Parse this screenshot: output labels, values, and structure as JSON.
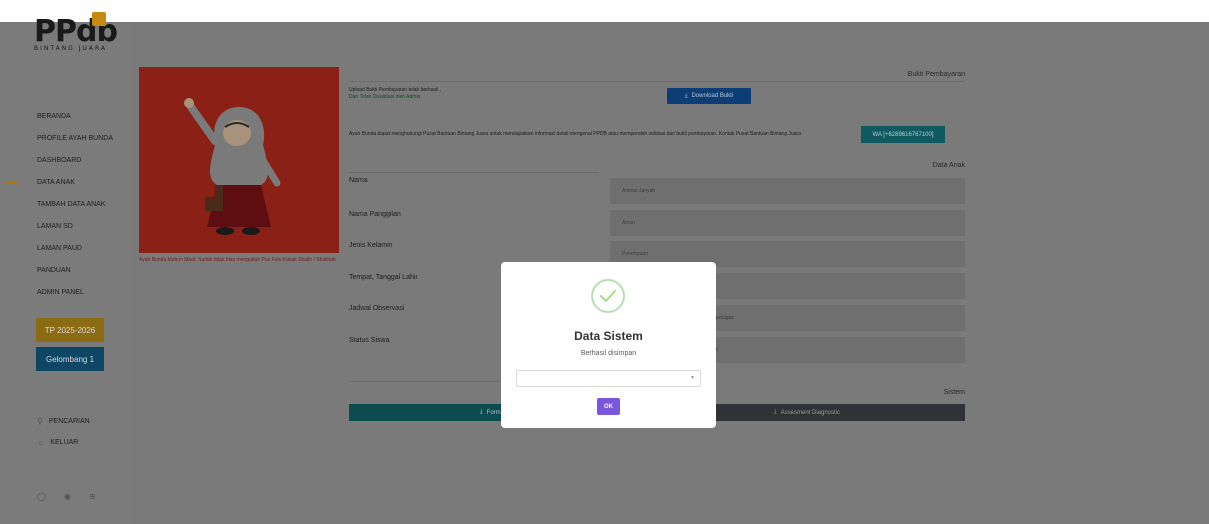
{
  "logo": {
    "text": "PPdb",
    "subtitle": "BINTANG JUARA"
  },
  "nav": {
    "items": [
      {
        "label": "BERANDA"
      },
      {
        "label": "PROFILE AYAH BUNDA"
      },
      {
        "label": "DASHBOARD"
      },
      {
        "label": "DATA ANAK",
        "active": true
      },
      {
        "label": "TAMBAH DATA ANAK"
      },
      {
        "label": "LAMAN SD"
      },
      {
        "label": "LAMAN PAUD"
      },
      {
        "label": "PANDUAN"
      },
      {
        "label": "ADMIN PANEL"
      }
    ],
    "tp_button": "TP 2025-2026",
    "gelombang_button": "Gelombang 1",
    "search_link": "PENCARIAN",
    "logout_link": "KELUAR",
    "social_icons": [
      "instagram-icon",
      "facebook-icon",
      "globe-icon"
    ]
  },
  "photo": {
    "note": "Ayah Bunda Mohon Maaf, Sudah tidak bisa mengubah Pas Foto Kakak Shalih / Shalihah"
  },
  "bukti": {
    "title": "Bukti Pembayaran",
    "upload_msg": "Upload Bukti Pembayaran telah berhasil ,",
    "validated_msg": "Dan Telah Divalidasi oleh Admin",
    "download_label": "Download Bukti",
    "contact_text": "Ayah Bunda dapat menghubungi Pusat Bantuan Bintang Juara untuk mendapatkan informasi detail mengenai PPDB atau memperoleh validasi dari bukti pembayaran. Kontak Pusat Bantuan Bintang Juara",
    "wa_label": "WA [+6289616767100]"
  },
  "data_anak": {
    "title": "Data Anak",
    "rows": [
      {
        "label": "Nama",
        "value": "Aninun Jariyah"
      },
      {
        "label": "Nama Panggilan",
        "value": "Ainun"
      },
      {
        "label": "Jenis Kelamin",
        "value": "Perempuan"
      },
      {
        "label": "Tempat, Tanggal Lahir",
        "value": ""
      },
      {
        "label": "Jadwal Observasi",
        "value": "petugas"
      },
      {
        "label": "Status Siswa",
        "value": "ai"
      }
    ]
  },
  "sistem": {
    "title": "Sistem",
    "form_button": "Form Perke",
    "assessment_button": "Assesment Diagnostic"
  },
  "modal": {
    "title": "Data Sistem",
    "subtitle": "Berhasil disimpan",
    "select_value": "",
    "ok_label": "OK"
  },
  "colors": {
    "accent_gold": "#c78a11",
    "primary_blue": "#0c3e75",
    "teal": "#0f5a60",
    "ok_purple": "#7b57de",
    "success_green": "#b6e0b0"
  }
}
